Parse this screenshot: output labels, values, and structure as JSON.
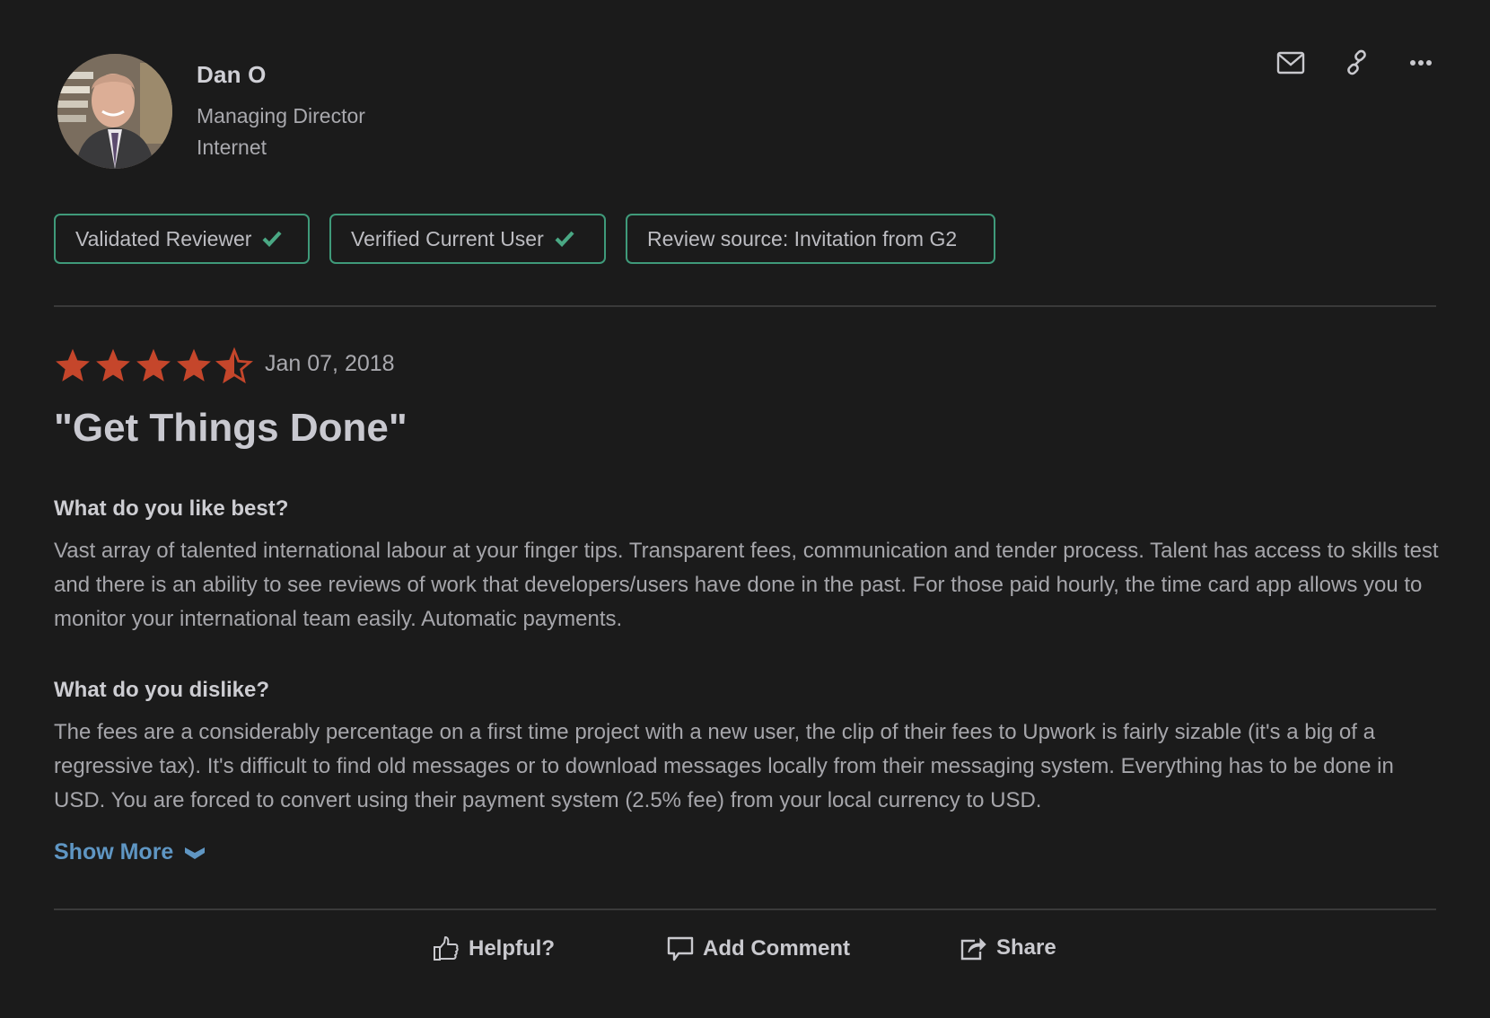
{
  "reviewer": {
    "name": "Dan O",
    "title": "Managing Director",
    "company": "Internet",
    "avatar_alt": "reviewer-photo"
  },
  "header_actions": [
    {
      "icon": "mail-icon",
      "label": "Email"
    },
    {
      "icon": "link-icon",
      "label": "Copy link"
    },
    {
      "icon": "more-icon",
      "label": "More options"
    }
  ],
  "badges": [
    {
      "label": "Validated Reviewer",
      "checked": true
    },
    {
      "label": "Verified Current User",
      "checked": true
    },
    {
      "label": "Review source: Invitation from G2",
      "checked": false
    }
  ],
  "rating": {
    "value": 4.5,
    "max": 5,
    "date": "Jan 07, 2018"
  },
  "review": {
    "title": "\"Get Things Done\"",
    "sections": [
      {
        "question": "What do you like best?",
        "answer": "Vast array of talented international labour at your finger tips. Transparent fees, communication and tender process. Talent has access to skills test and there is an ability to see reviews of work that developers/users have done in the past. For those paid hourly, the time card app allows you to monitor your international team easily. Automatic payments."
      },
      {
        "question": "What do you dislike?",
        "answer": "The fees are a considerably percentage on a first time project with a new user, the clip of their fees to Upwork is fairly sizable (it's a big of a regressive tax). It's difficult to find old messages or to download messages locally from their messaging system. Everything has to be done in USD. You are forced to convert using their payment system (2.5% fee) from your local currency to USD."
      }
    ],
    "show_more_label": "Show More"
  },
  "footer_actions": {
    "helpful": "Helpful?",
    "comment": "Add Comment",
    "share": "Share"
  },
  "colors": {
    "background": "#1b1b1b",
    "star": "#c5462b",
    "badge_border": "#3f9a7a",
    "check": "#4aa884",
    "link": "#5f96c3"
  }
}
